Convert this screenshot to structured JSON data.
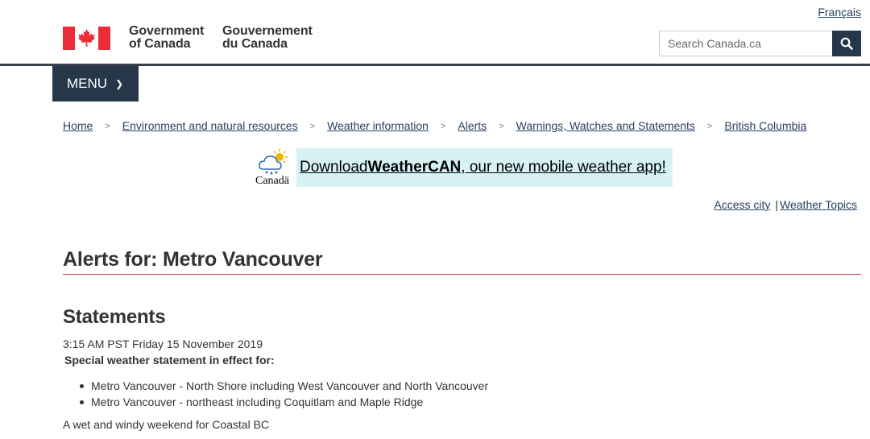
{
  "header": {
    "language_link": "Français",
    "wordmark_en": [
      "Government",
      "of Canada"
    ],
    "wordmark_fr": [
      "Gouvernement",
      "du Canada"
    ],
    "search_placeholder": "Search Canada.ca",
    "flag_color": "#eb2d37"
  },
  "menu": {
    "label": "MENU"
  },
  "breadcrumb": [
    "Home",
    "Environment and natural resources",
    "Weather information",
    "Alerts",
    "Warnings, Watches and Statements",
    "British Columbia"
  ],
  "banner": {
    "logo_text": "Canadä",
    "prefix": "Download ",
    "app_name": "WeatherCAN",
    "suffix": ", our new mobile weather app!"
  },
  "links": {
    "access_city": "Access city",
    "weather_topics": "Weather Topics"
  },
  "main": {
    "title": "Alerts for: Metro Vancouver",
    "section_heading": "Statements",
    "timestamp": "3:15 AM PST Friday 15 November 2019",
    "statement_heading": "Special weather statement in effect for:",
    "regions": [
      "Metro Vancouver - North Shore including West Vancouver and North Vancouver",
      "Metro Vancouver - northeast including Coquitlam and Maple Ridge"
    ],
    "summary": "A wet and windy weekend for Coastal BC"
  }
}
